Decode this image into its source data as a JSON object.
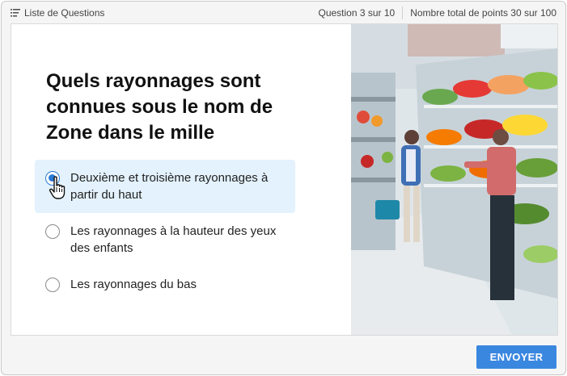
{
  "header": {
    "list_label": "Liste de Questions",
    "question_progress": "Question 3 sur 10",
    "points_total": "Nombre total de points 30 sur 100"
  },
  "question": {
    "title": "Quels rayonnages sont connues sous le nom de Zone dans le mille",
    "options": [
      {
        "label": "Deuxième et troisième rayonnages à partir du haut",
        "selected": true
      },
      {
        "label": "Les rayonnages à la hauteur des yeux des enfants",
        "selected": false
      },
      {
        "label": "Les rayonnages du bas",
        "selected": false
      }
    ],
    "image_subject": "supermarket produce aisle with shoppers"
  },
  "footer": {
    "submit_label": "ENVOYER"
  },
  "colors": {
    "accent": "#3a87e0",
    "selected_bg": "#e3f2fd",
    "radio_selected": "#2a7ad5"
  },
  "icons": [
    "list-icon",
    "hand-pointer-cursor-icon"
  ]
}
